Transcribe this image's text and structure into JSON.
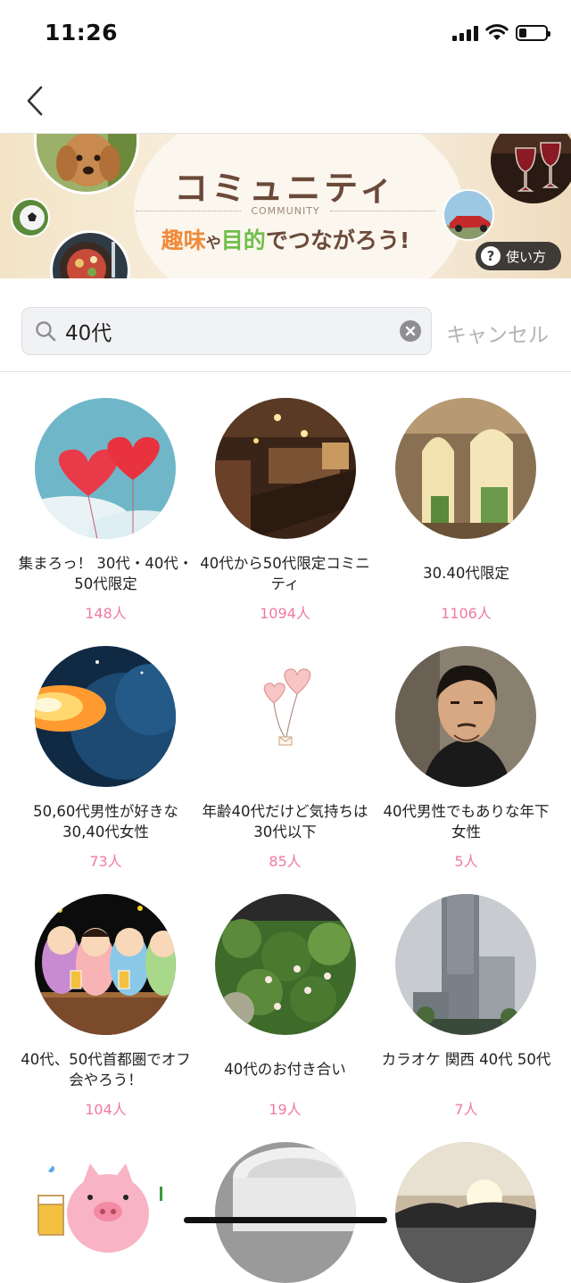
{
  "status": {
    "time": "11:26",
    "battery_level": 0.28
  },
  "nav": {
    "back_icon": "chevron-left-icon"
  },
  "banner": {
    "title": "コミュニティ",
    "subtitle": "COMMUNITY",
    "tagline_1": "趣味",
    "tagline_2": "や",
    "tagline_3": "目的",
    "tagline_4": "でつながろう!",
    "howto_label": "使い方",
    "howto_icon": "?"
  },
  "search": {
    "value": "40代",
    "cancel_label": "キャンセル"
  },
  "communities": [
    {
      "name": "集まろっ！ 30代・40代・50代限定",
      "count": "148人"
    },
    {
      "name": "40代から50代限定コミニティ",
      "count": "1094人"
    },
    {
      "name": "30.40代限定",
      "count": "1106人"
    },
    {
      "name": "50,60代男性が好きな30,40代女性",
      "count": "73人"
    },
    {
      "name": "年齢40代だけど気持ちは30代以下",
      "count": "85人"
    },
    {
      "name": "40代男性でもありな年下女性",
      "count": "5人"
    },
    {
      "name": "40代、50代首都圏でオフ会やろう！",
      "count": "104人"
    },
    {
      "name": "40代のお付き合い",
      "count": "19人"
    },
    {
      "name": "カラオケ 関西 40代 50代",
      "count": "7人"
    }
  ]
}
